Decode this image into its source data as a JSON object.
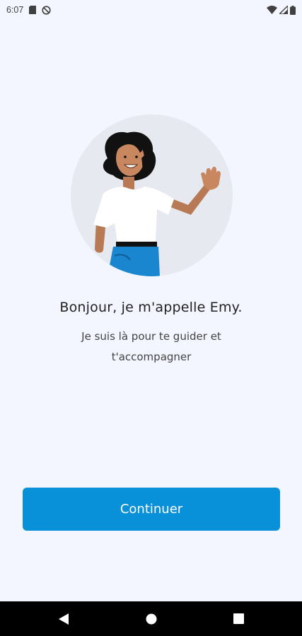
{
  "status_bar": {
    "time": "6:07",
    "icons": [
      "sd-card-icon",
      "no-sync-icon",
      "wifi-icon",
      "cell-signal-icon",
      "battery-icon"
    ]
  },
  "onboarding": {
    "greeting": "Bonjour, je m'appelle Emy.",
    "subtitle": "Je suis là pour te guider et t'accompagner",
    "continue_label": "Continuer"
  },
  "colors": {
    "background": "#f3f6fe",
    "primary_button": "#0891d9",
    "avatar_circle": "#e6e9f0",
    "skirt": "#1a86cf"
  },
  "nav_bar": {
    "icons": [
      "back-icon",
      "home-icon",
      "recents-icon"
    ]
  }
}
